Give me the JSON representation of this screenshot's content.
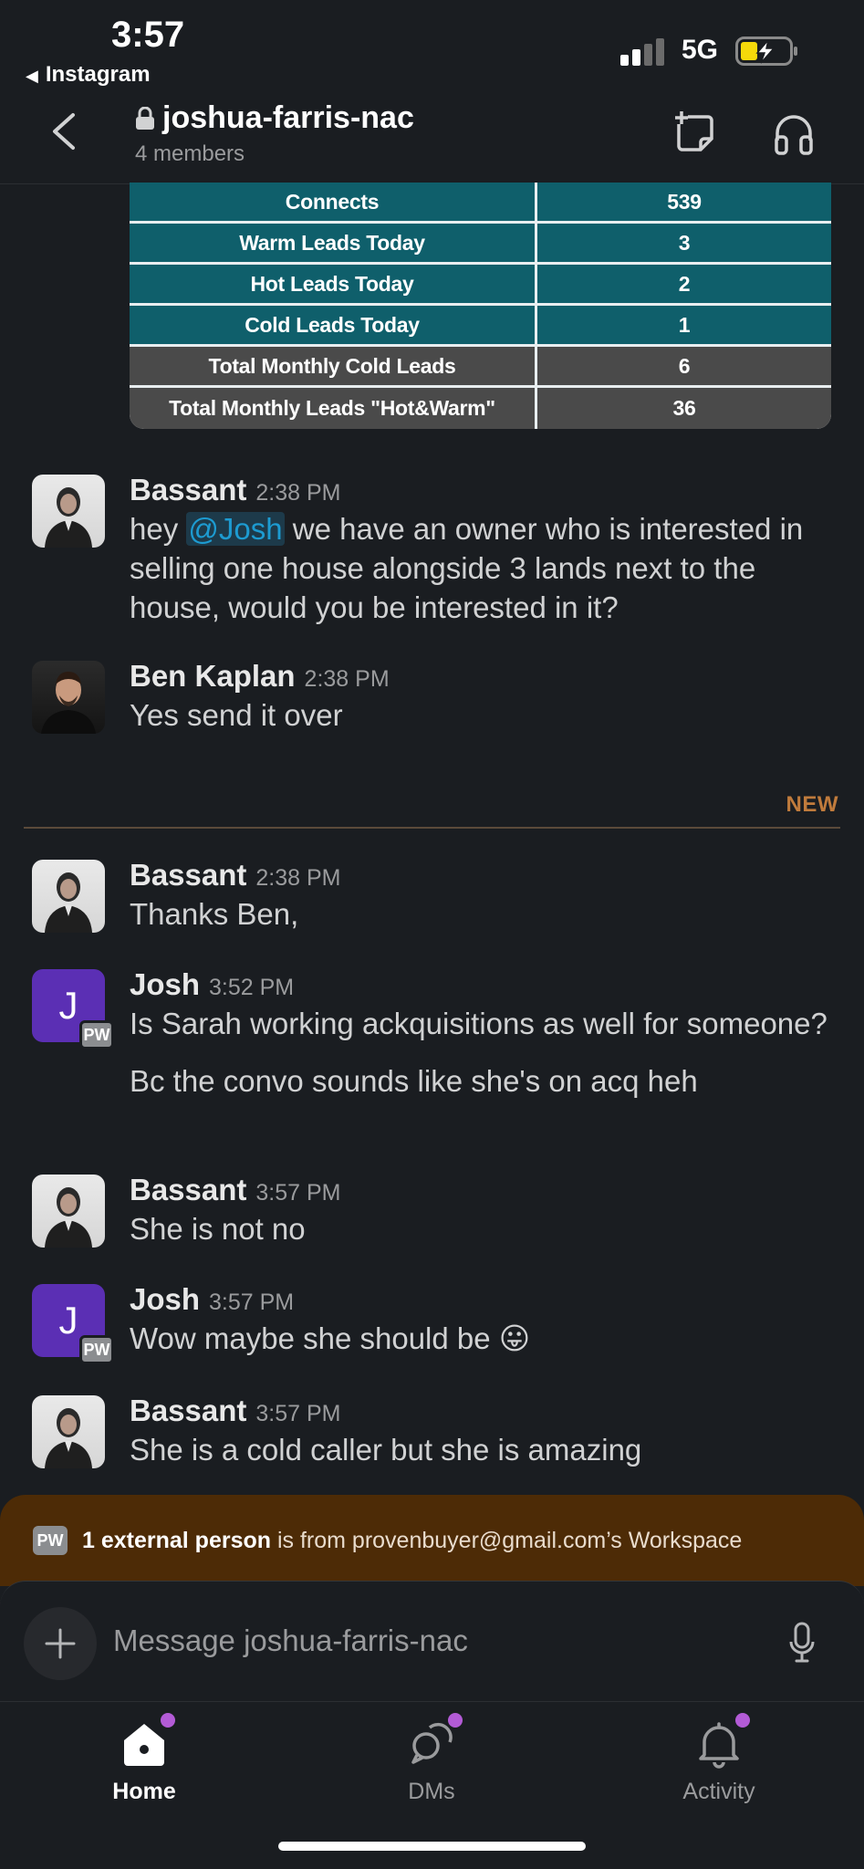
{
  "status_bar": {
    "time": "3:57",
    "back_app": "Instagram",
    "network": "5G"
  },
  "header": {
    "channel": "joshua-farris-nac",
    "members": "4 members"
  },
  "report_table": {
    "rows": [
      {
        "label": "Connects",
        "value": "539",
        "style": "teal"
      },
      {
        "label": "Warm Leads Today",
        "value": "3",
        "style": "teal"
      },
      {
        "label": "Hot Leads Today",
        "value": "2",
        "style": "teal"
      },
      {
        "label": "Cold Leads Today",
        "value": "1",
        "style": "teal"
      },
      {
        "label": "Total Monthly Cold Leads",
        "value": "6",
        "style": "gray"
      },
      {
        "label": "Total Monthly Leads \"Hot&Warm\"",
        "value": "36",
        "style": "gray"
      }
    ]
  },
  "messages": [
    {
      "author": "Bassant",
      "time": "2:38 PM",
      "mention": "@Josh",
      "text_before": "hey ",
      "text_after": " we have an owner who is interested in selling one house alongside 3 lands next to the house, would you be interested in it?"
    },
    {
      "author": "Ben Kaplan",
      "time": "2:38 PM",
      "text": "Yes send it over"
    },
    {
      "author": "Bassant",
      "time": "2:38 PM",
      "text": "Thanks Ben,"
    },
    {
      "author": "Josh",
      "time": "3:52 PM",
      "avatar_letter": "J",
      "badge": "PW",
      "text": "Is Sarah working ackquisitions as well for someone?",
      "text2": "Bc the convo sounds like she's on acq heh"
    },
    {
      "author": "Bassant",
      "time": "3:57 PM",
      "text": "She is not no"
    },
    {
      "author": "Josh",
      "time": "3:57 PM",
      "avatar_letter": "J",
      "badge": "PW",
      "text": "Wow maybe she should be 😛"
    },
    {
      "author": "Bassant",
      "time": "3:57 PM",
      "text": "She is a cold caller but she is amazing"
    }
  ],
  "new_divider": "NEW",
  "external_banner": {
    "badge": "PW",
    "bold": "1 external person",
    "rest": " is from provenbuyer@gmail.com’s Workspace"
  },
  "composer": {
    "placeholder": "Message joshua-farris-nac"
  },
  "tabs": [
    {
      "label": "Home",
      "icon": "home-icon",
      "active": true
    },
    {
      "label": "DMs",
      "icon": "dms-icon",
      "active": false
    },
    {
      "label": "Activity",
      "icon": "bell-icon",
      "active": false
    }
  ],
  "colors": {
    "accent_link": "#1d9bd1",
    "new_label": "#c07b3c",
    "notification_dot": "#b35bd6",
    "banner_bg": "#4d2b06",
    "josh_avatar": "#5b2fb4"
  }
}
